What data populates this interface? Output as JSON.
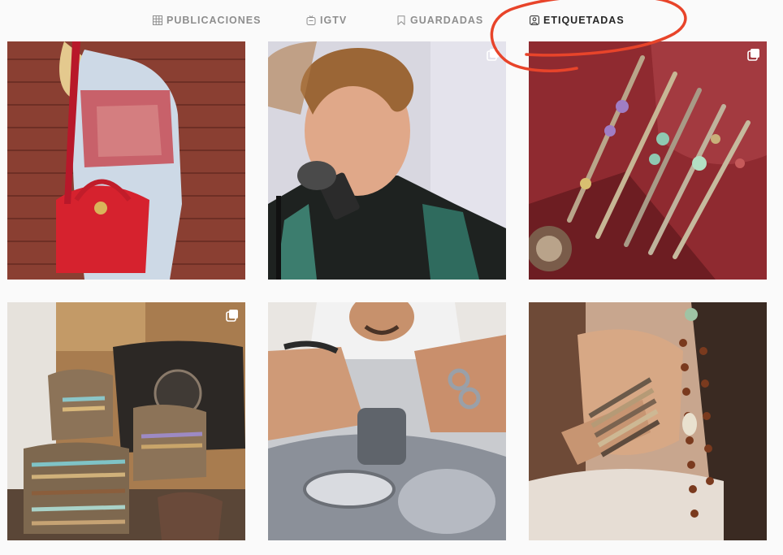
{
  "tabs": [
    {
      "label": "PUBLICACIONES",
      "icon": "grid-icon",
      "active": false
    },
    {
      "label": "IGTV",
      "icon": "tv-icon",
      "active": false
    },
    {
      "label": "GUARDADAS",
      "icon": "bookmark-icon",
      "active": false
    },
    {
      "label": "ETIQUETADAS",
      "icon": "tagged-user-icon",
      "active": true
    }
  ],
  "annotation": {
    "color": "#e8442a"
  },
  "posts": [
    {
      "subject": "woman with red quilted handbag against wood wall",
      "multiple": false
    },
    {
      "subject": "young man singing at microphone",
      "multiple": true
    },
    {
      "subject": "beaded bracelets on red cushion",
      "multiple": true
    },
    {
      "subject": "bracelet display with leather bags",
      "multiple": true
    },
    {
      "subject": "man with rings working on motorcycle engine",
      "multiple": false
    },
    {
      "subject": "woman wearing stacked bracelets and long beads",
      "multiple": false
    }
  ]
}
